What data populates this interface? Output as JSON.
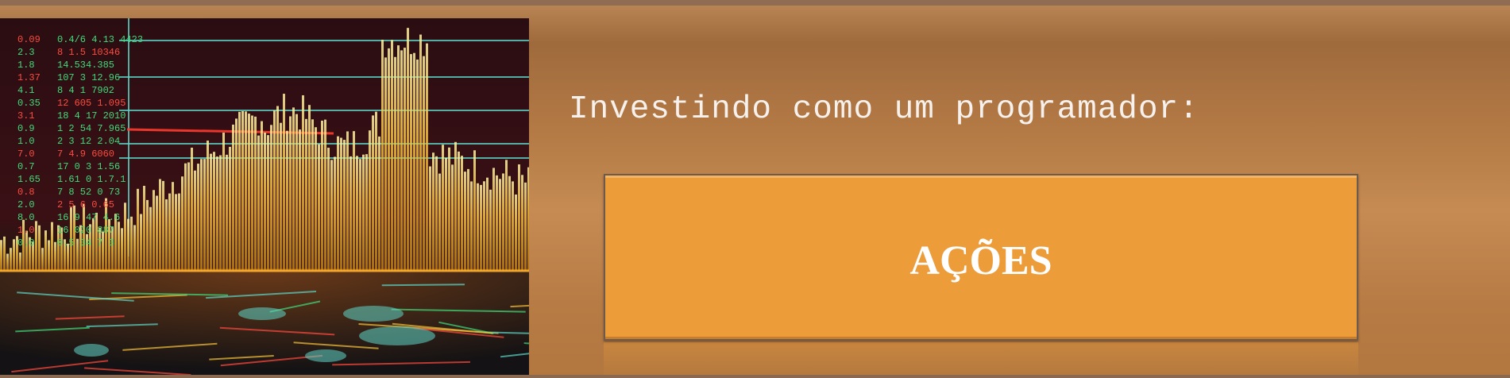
{
  "banner": {
    "subtitle": "Investindo como um programador:",
    "title": "AÇÕES"
  },
  "hero_image": {
    "description_icon": "stock-chart-image",
    "ticker_rows": [
      "0.4/6 4.13 4423",
      "8 1.5 10346",
      "14.534.385",
      "107 3 12.96",
      "8 4 1 7902",
      "12 605 1.095",
      "18 4 17 2010",
      "1 2 54 7.965",
      "2 3 12 2.04",
      "7 4.9 6060",
      "17 0 3 1.56",
      "1.61 0 1.7.1",
      "7 8 52 0 73",
      "2 5 6 0.65",
      "16 9 47 4.6",
      "16 020 887",
      "0.5 34 7 3"
    ],
    "left_numbers": [
      "0.09",
      "2.3",
      "1.8",
      "1.37",
      "4.1",
      "0.35",
      "3.1",
      "0.9",
      "1.0",
      "7.0",
      "0.7",
      "1.65",
      "0.8",
      "2.0",
      "8.0",
      "1.0",
      "0.0"
    ],
    "colors": {
      "accent_yellow": "#f6c23a",
      "grid_cyan": "#5ed6c8",
      "ticker_green": "#3fdc7a",
      "ticker_red": "#ff4b3e"
    }
  },
  "colors": {
    "background": "#b57b46",
    "box": "#ed9c3a",
    "text": "#ffffff"
  }
}
